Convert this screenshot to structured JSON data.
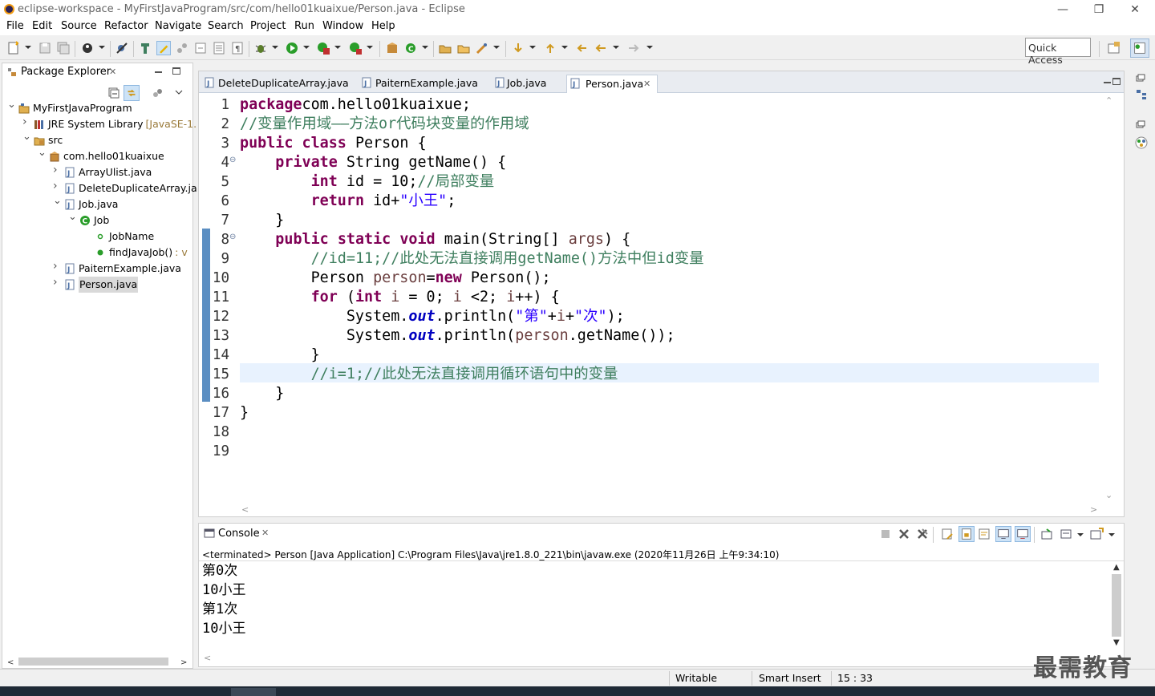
{
  "window": {
    "title": "eclipse-workspace - MyFirstJavaProgram/src/com/hello01kuaixue/Person.java - Eclipse",
    "minimize": "—",
    "restore": "❐",
    "close": "✕"
  },
  "menu": [
    "File",
    "Edit",
    "Source",
    "Refactor",
    "Navigate",
    "Search",
    "Project",
    "Run",
    "Window",
    "Help"
  ],
  "quick_access": "Quick Access",
  "package_explorer": {
    "title": "Package Explorer",
    "close": "✕",
    "tree": [
      {
        "label": "MyFirstJavaProgram",
        "icon": "project-icon",
        "depth": 0,
        "twisty": "open"
      },
      {
        "label": "JRE System Library",
        "suffix": "[JavaSE-1.",
        "icon": "library-icon",
        "depth": 1,
        "twisty": "closed"
      },
      {
        "label": "src",
        "icon": "source-folder-icon",
        "depth": 1,
        "twisty": "open"
      },
      {
        "label": "com.hello01kuaixue",
        "icon": "package-icon",
        "depth": 2,
        "twisty": "open"
      },
      {
        "label": "ArrayUlist.java",
        "icon": "java-file-icon",
        "depth": 3,
        "twisty": "closed"
      },
      {
        "label": "DeleteDuplicateArray.ja",
        "icon": "java-file-icon",
        "depth": 3,
        "twisty": "closed"
      },
      {
        "label": "Job.java",
        "icon": "java-file-icon",
        "depth": 3,
        "twisty": "open"
      },
      {
        "label": "Job",
        "icon": "class-icon",
        "depth": 4,
        "twisty": "open"
      },
      {
        "label": "JobName",
        "icon": "field-icon",
        "depth": 5,
        "twisty": "none"
      },
      {
        "label": "findJavaJob()",
        "suffix": ": v",
        "icon": "method-icon",
        "depth": 5,
        "twisty": "none"
      },
      {
        "label": "PaiternExample.java",
        "icon": "java-file-icon",
        "depth": 3,
        "twisty": "closed"
      },
      {
        "label": "Person.java",
        "icon": "java-file-icon",
        "depth": 3,
        "twisty": "closed",
        "selected": true
      }
    ]
  },
  "editor": {
    "tabs": [
      {
        "label": "DeleteDuplicateArray.java",
        "active": false
      },
      {
        "label": "PaiternExample.java",
        "active": false
      },
      {
        "label": "Job.java",
        "active": false
      },
      {
        "label": "Person.java",
        "active": true,
        "close": "✕"
      }
    ],
    "line_numbers": [
      "1",
      "2",
      "3",
      "4",
      "5",
      "6",
      "7",
      "8",
      "9",
      "10",
      "11",
      "12",
      "13",
      "14",
      "15",
      "16",
      "17",
      "18",
      "19"
    ],
    "fold_markers": {
      "4": "⊖",
      "8": "⊖"
    },
    "current_line": "15",
    "lines": [
      [
        [
          "kw",
          "package"
        ],
        [
          "",
          "com.hello01kuaixue;"
        ]
      ],
      [
        [
          "cm",
          "//变量作用域——方法or代码块变量的作用域"
        ]
      ],
      [
        [
          "kw",
          "public"
        ],
        [
          "",
          " "
        ],
        [
          "kw",
          "class"
        ],
        [
          "",
          " Person {"
        ]
      ],
      [
        [
          "",
          "    "
        ],
        [
          "kw",
          "private"
        ],
        [
          "",
          " String getName() {"
        ]
      ],
      [
        [
          "",
          "        "
        ],
        [
          "kw",
          "int"
        ],
        [
          "",
          " id = 10;"
        ],
        [
          "cm",
          "//局部变量"
        ]
      ],
      [
        [
          "",
          "        "
        ],
        [
          "kw",
          "return"
        ],
        [
          "",
          " id+"
        ],
        [
          "st",
          "\"小王\""
        ],
        [
          "",
          ";"
        ]
      ],
      [
        [
          "",
          "    }"
        ]
      ],
      [
        [
          "",
          "    "
        ],
        [
          "kw",
          "public"
        ],
        [
          "",
          " "
        ],
        [
          "kw",
          "static"
        ],
        [
          "",
          " "
        ],
        [
          "kw",
          "void"
        ],
        [
          "",
          " main(String[] "
        ],
        [
          "lv",
          "args"
        ],
        [
          "",
          ") {"
        ]
      ],
      [
        [
          "",
          "        "
        ],
        [
          "cm",
          "//id=11;//此处无法直接调用getName()方法中但id变量"
        ]
      ],
      [
        [
          "",
          "        Person "
        ],
        [
          "lv",
          "person"
        ],
        [
          "",
          "="
        ],
        [
          "kw",
          "new"
        ],
        [
          "",
          " Person();"
        ]
      ],
      [
        [
          "",
          "        "
        ],
        [
          "kw",
          "for"
        ],
        [
          "",
          " ("
        ],
        [
          "kw",
          "int"
        ],
        [
          "",
          " "
        ],
        [
          "lv",
          "i"
        ],
        [
          "",
          " = 0; "
        ],
        [
          "lv",
          "i"
        ],
        [
          "",
          " <2; "
        ],
        [
          "lv",
          "i"
        ],
        [
          "",
          "++) {"
        ]
      ],
      [
        [
          "",
          "            System."
        ],
        [
          "fd",
          "out"
        ],
        [
          "",
          ".println("
        ],
        [
          "st",
          "\"第\""
        ],
        [
          "",
          "+"
        ],
        [
          "lv",
          "i"
        ],
        [
          "",
          "+"
        ],
        [
          "st",
          "\"次\""
        ],
        [
          "",
          ");"
        ]
      ],
      [
        [
          "",
          "            System."
        ],
        [
          "fd",
          "out"
        ],
        [
          "",
          ".println("
        ],
        [
          "lv",
          "person"
        ],
        [
          "",
          ".getName());"
        ]
      ],
      [
        [
          "",
          "        }"
        ]
      ],
      [
        [
          "",
          "        "
        ],
        [
          "cm",
          "//i=1;//此处无法直接调用循环语句中的变量"
        ]
      ],
      [
        [
          "",
          "    }"
        ]
      ],
      [
        [
          "",
          "}"
        ]
      ],
      [
        [
          "",
          ""
        ]
      ],
      [
        [
          "",
          ""
        ]
      ]
    ]
  },
  "console": {
    "title": "Console",
    "close": "✕",
    "status": "<terminated> Person [Java Application] C:\\Program Files\\Java\\jre1.8.0_221\\bin\\javaw.exe (2020年11月26日 上午9:34:10)",
    "output": [
      "第0次",
      "10小王",
      "第1次",
      "10小王"
    ]
  },
  "statusbar": {
    "writable": "Writable",
    "insert_mode": "Smart Insert",
    "position": "15 : 33"
  },
  "watermark": "最需教育",
  "colors": {
    "keyword": "#7f0055",
    "comment": "#3f7f5f",
    "string": "#2a00ff",
    "field": "#0000c0",
    "local": "#6a3e3e",
    "current_line": "#e8f2fe",
    "selection": "#d9d9d9"
  }
}
